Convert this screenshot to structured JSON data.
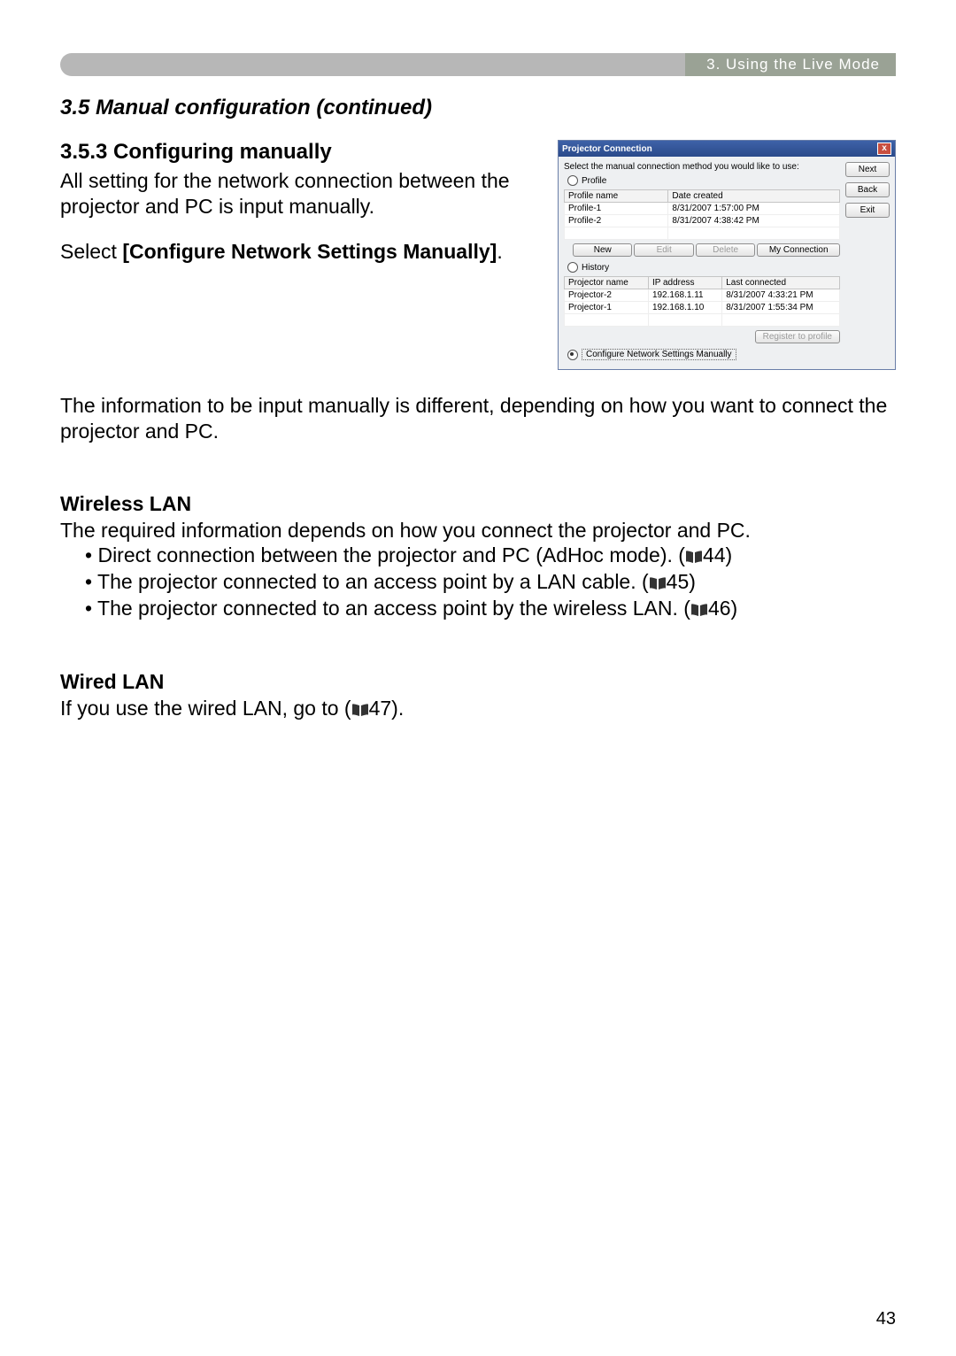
{
  "header": {
    "chapter_label": "3. Using the Live Mode"
  },
  "section": {
    "title": "3.5 Manual configuration (continued)",
    "subsection_title": "3.5.3 Configuring manually",
    "intro_p1": "All setting for the network connection between the projector and PC is input manually.",
    "intro_p2a": "Select ",
    "intro_p2b": "[Configure Network Settings Manually]",
    "intro_p2c": "."
  },
  "dialog": {
    "title": "Projector Connection",
    "prompt": "Select the manual connection method you would like to use:",
    "radio_profile": "Profile",
    "profile_headers": [
      "Profile name",
      "Date created"
    ],
    "profile_rows": [
      {
        "name": "Profile-1",
        "date": "8/31/2007 1:57:00 PM"
      },
      {
        "name": "Profile-2",
        "date": "8/31/2007 4:38:42 PM"
      }
    ],
    "btn_new": "New",
    "btn_edit": "Edit",
    "btn_delete": "Delete",
    "btn_myconn": "My Connection",
    "radio_history": "History",
    "history_headers": [
      "Projector name",
      "IP address",
      "Last connected"
    ],
    "history_rows": [
      {
        "name": "Projector-2",
        "ip": "192.168.1.11",
        "date": "8/31/2007 4:33:21 PM"
      },
      {
        "name": "Projector-1",
        "ip": "192.168.1.10",
        "date": "8/31/2007 1:55:34 PM"
      }
    ],
    "btn_register": "Register to profile",
    "radio_manual": "Configure Network Settings Manually",
    "side_next": "Next",
    "side_back": "Back",
    "side_exit": "Exit"
  },
  "info_para": "The information to be input manually is different, depending on how you want to connect the projector and PC.",
  "wireless": {
    "heading": "Wireless LAN",
    "intro": "The required information depends on how you connect the projector and PC.",
    "bullets": [
      {
        "text_a": "Direct connection between the projector and PC (AdHoc mode). (",
        "ref": "44",
        "text_b": ")"
      },
      {
        "text_a": "The projector connected to an access point by a LAN cable. (",
        "ref": "45",
        "text_b": ")"
      },
      {
        "text_a": "The projector connected to an access point by the wireless LAN. (",
        "ref": "46",
        "text_b": ")"
      }
    ]
  },
  "wired": {
    "heading": "Wired LAN",
    "text_a": "If you use the wired LAN, go to (",
    "ref": "47",
    "text_b": ")."
  },
  "page_number": "43"
}
